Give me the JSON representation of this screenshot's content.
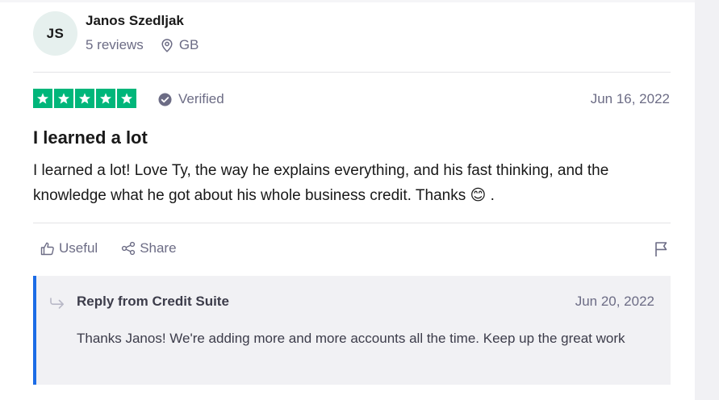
{
  "reviewer": {
    "initials": "JS",
    "name": "Janos Szedljak",
    "reviews_count": "5 reviews",
    "country": "GB"
  },
  "review": {
    "rating": 5,
    "max_rating": 5,
    "verified_label": "Verified",
    "date": "Jun 16, 2022",
    "title": "I learned a lot",
    "text": "I learned a lot! Love Ty, the way he explains everything, and his fast thinking, and the knowledge what he got about his whole business credit. Thanks",
    "emoji": "😊",
    "text_end": "."
  },
  "actions": {
    "useful_label": "Useful",
    "share_label": "Share"
  },
  "reply": {
    "title": "Reply from Credit Suite",
    "date": "Jun 20, 2022",
    "text": "Thanks Janos! We're adding more and more accounts all the time. Keep up the great work"
  },
  "colors": {
    "star_green": "#00b67a",
    "reply_accent": "#1c6ce6",
    "muted_text": "#6c6c85"
  }
}
